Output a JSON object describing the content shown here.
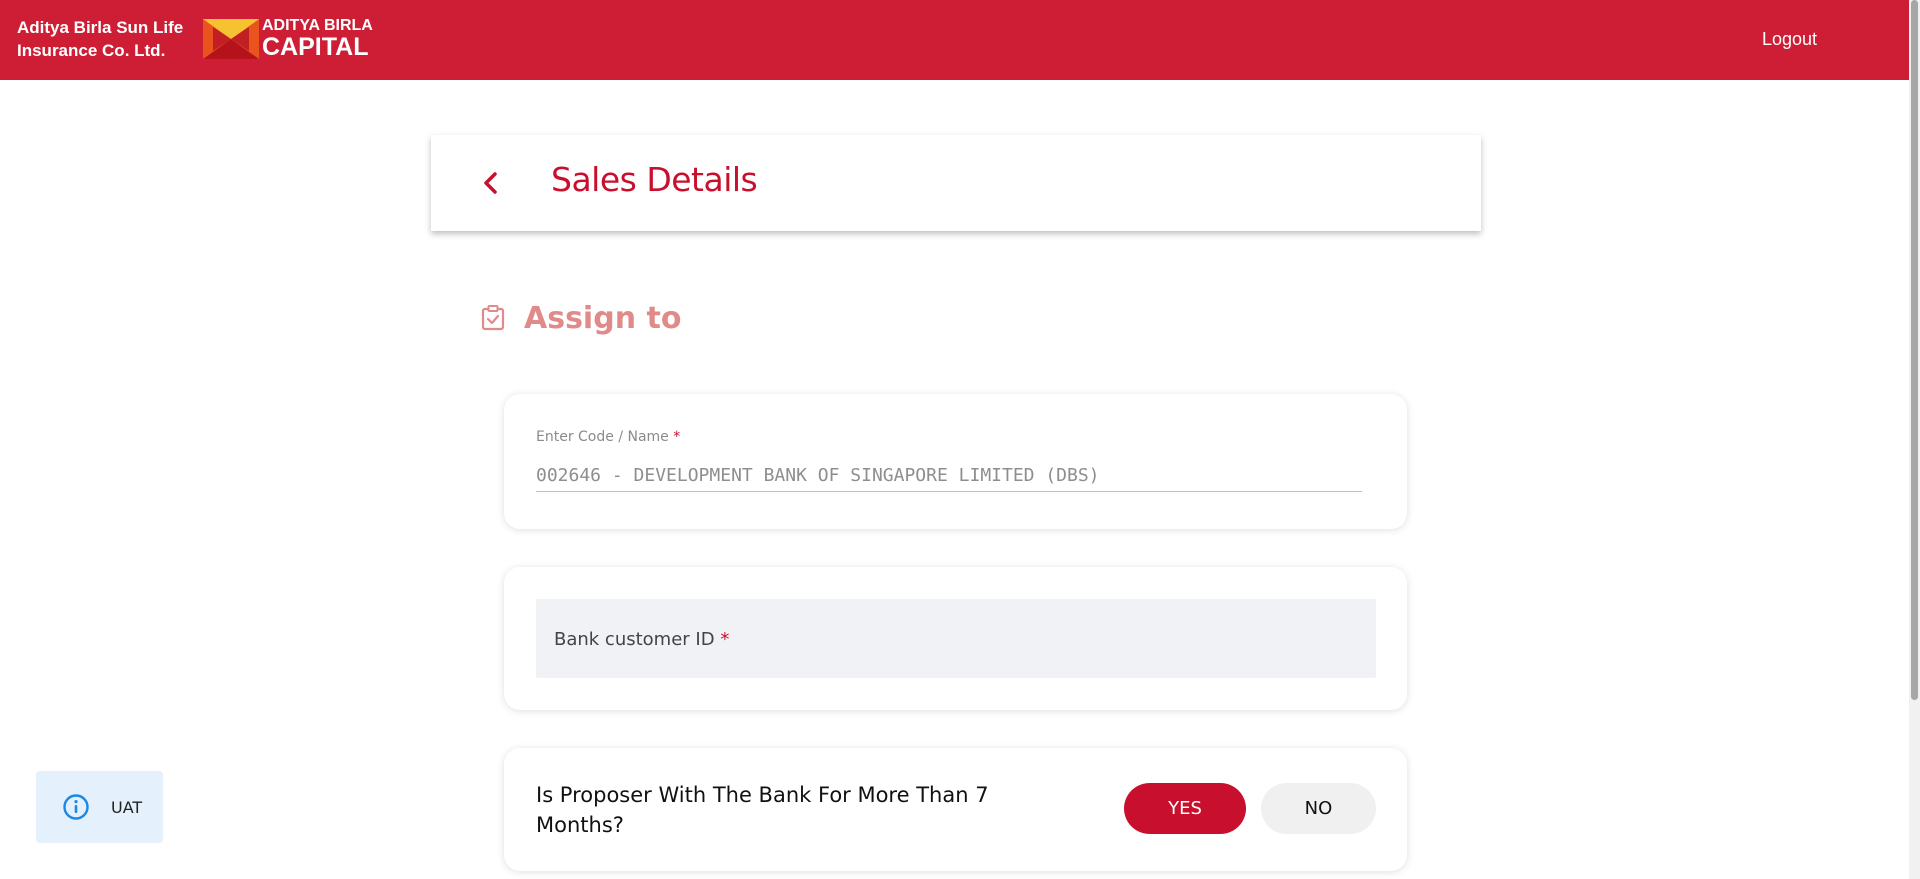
{
  "header": {
    "brand_line1": "Aditya Birla Sun Life",
    "brand_line2": "Insurance Co. Ltd.",
    "logo_line1": "ADITYA BIRLA",
    "logo_line2": "CAPITAL",
    "logout_label": "Logout",
    "background_color": "#ce1e36"
  },
  "sales_card": {
    "title": "Sales Details",
    "back_icon": "chevron-left-icon"
  },
  "section": {
    "title": "Assign to",
    "icon": "clipboard-check-icon"
  },
  "code_field": {
    "label": "Enter Code / Name",
    "required_mark": "*",
    "value": "002646 - DEVELOPMENT BANK OF SINGAPORE LIMITED (DBS)"
  },
  "bank_id_field": {
    "label": "Bank customer ID",
    "required_mark": "*"
  },
  "proposer_question": {
    "text": "Is Proposer With The Bank For More Than 7 Months?",
    "yes_label": "YES",
    "no_label": "NO",
    "selected": "YES"
  },
  "env_badge": {
    "label": "UAT",
    "icon": "info-icon"
  },
  "colors": {
    "primary": "#c8102e",
    "section_title": "#e08a8a",
    "badge_bg": "#e4f0fb",
    "info_icon": "#1e88e5"
  }
}
